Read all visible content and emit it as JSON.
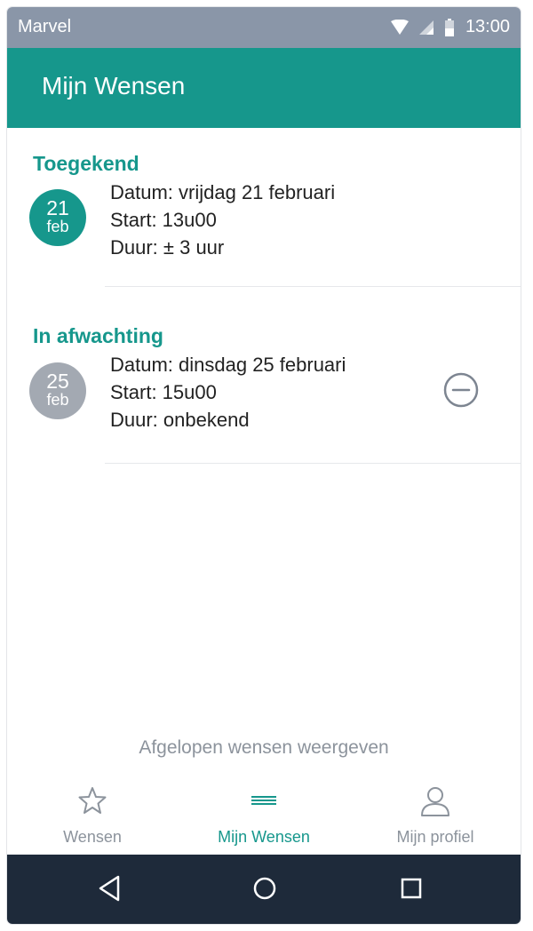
{
  "status_bar": {
    "carrier": "Marvel",
    "time": "13:00"
  },
  "app_bar": {
    "title": "Mijn Wensen"
  },
  "sections": [
    {
      "title": "Toegekend",
      "day": "21",
      "month": "feb",
      "lines": [
        "Datum: vrijdag 21 februari",
        "Start: 13u00",
        "Duur: ± 3 uur"
      ],
      "status_color": "#16978c"
    },
    {
      "title": "In afwachting",
      "day": "25",
      "month": "feb",
      "lines": [
        "Datum: dinsdag 25 februari",
        "Start: 15u00",
        "Duur: onbekend"
      ],
      "status_color": "#a3a9b2",
      "action_icon": "remove-circle-icon"
    }
  ],
  "show_past_label": "Afgelopen wensen weergeven",
  "bottom_nav": [
    {
      "label": "Wensen",
      "icon": "star-icon",
      "active": false
    },
    {
      "label": "Mijn Wensen",
      "icon": "list-icon",
      "active": true
    },
    {
      "label": "Mijn profiel",
      "icon": "user-icon",
      "active": false
    }
  ],
  "colors": {
    "accent": "#16978c",
    "status_bar": "#8a96a8",
    "system_nav": "#1e2a3a"
  }
}
